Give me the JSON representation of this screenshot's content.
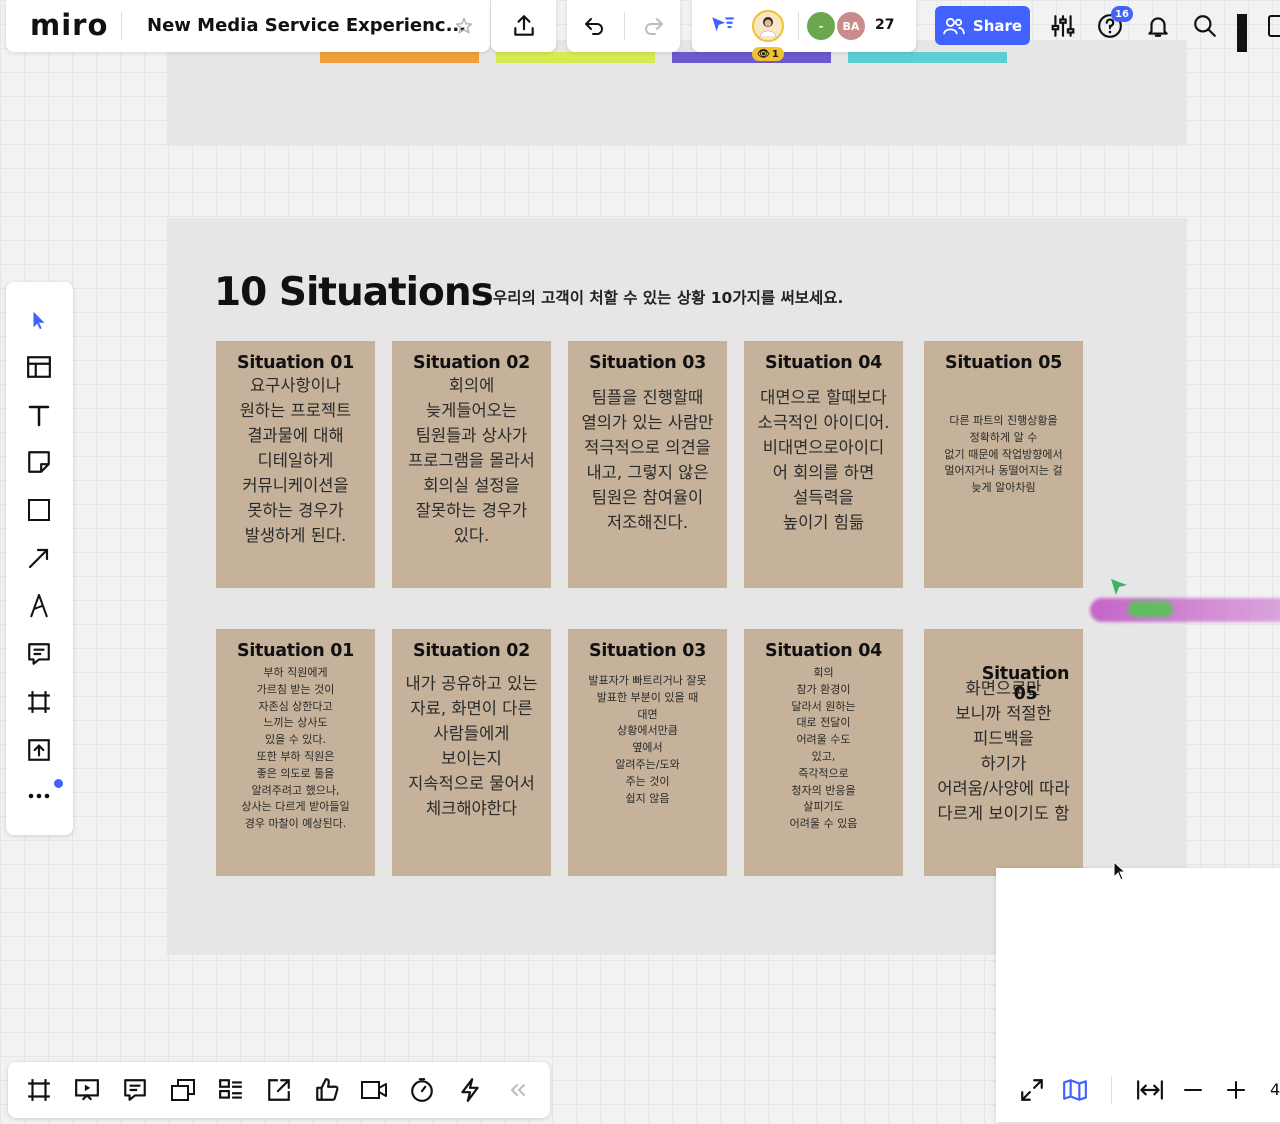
{
  "app": {
    "logo": "miro",
    "board_name": "New Media Service Experienc...",
    "share_label": "Share",
    "collaborator_count": "27",
    "viewer_count": "1",
    "help_badge": "16",
    "zoom_level": "4",
    "avatar_initials_ba": "BA",
    "avatar_initials_green": "-"
  },
  "board": {
    "title": "10 Situations",
    "subtitle": "우리의 고객이 처할 수 있는 상황 10가지를 써보세요.",
    "row1": [
      {
        "title": "Situation 01",
        "text": "요구사항이나\n원하는 프로젝트\n결과물에 대해\n디테일하게\n커뮤니케이션을\n못하는 경우가\n발생하게 된다."
      },
      {
        "title": "Situation 02",
        "text": "회의에\n늦게들어오는\n팀원들과 상사가\n프로그램을 몰라서\n회의실 설정을\n잘못하는 경우가\n있다."
      },
      {
        "title": "Situation 03",
        "text": "팀플을 진행할때\n열의가 있는 사람만\n적극적으로 의견을\n내고, 그렇지 않은\n팀원은 참여율이\n저조해진다."
      },
      {
        "title": "Situation 04",
        "text": "대면으로 할때보다\n소극적인 아이디어.\n비대면으로아이디\n어 회의를 하면\n설득력을\n높이기 힘듦"
      },
      {
        "title": "Situation 05",
        "text": "다른 파트의 진행상황을\n정확하게 알 수\n없기 때문에 작업방향에서\n멀어지거나 동떨어지는 걸\n늦게 알아차림"
      }
    ],
    "row2": [
      {
        "title": "Situation 01",
        "text": "부하 직원에게\n가르침 받는 것이\n자존심 상한다고\n느끼는 상사도\n있을 수 있다.\n또한 부하 직원은\n좋은 의도로 툴을\n알려주려고 했으나,\n상사는 다르게 받아들일\n경우 마찰이 예상된다."
      },
      {
        "title": "Situation 02",
        "text": "내가 공유하고 있는\n자료, 화면이 다른\n사람들에게\n보이는지\n지속적으로 물어서\n체크해야한다"
      },
      {
        "title": "Situation 03",
        "text": "발표자가 빠트리거나 잘못\n발표한 부분이 있을 때\n대면\n상황에서만큼\n옆에서\n알려주는/도와\n주는 것이\n쉽지 않음"
      },
      {
        "title": "Situation 04",
        "text": "회의\n참가 환경이\n달라서 원하는\n대로 전달이\n어려울 수도\n있고,\n즉각적으로\n청자의 반응을\n살피기도\n어려울 수 있음"
      },
      {
        "title": "Situation 05",
        "text": "화면으로만\n보니까 적절한\n피드백을\n하기가\n어려움/사양에 따라\n다르게 보이기도 함"
      }
    ]
  },
  "colors": {
    "accent": "#4262ff",
    "card": "#c6b29a",
    "frame": "#e6e6e6",
    "tab_orange": "#f0a13c",
    "tab_lime": "#d7ea4f",
    "tab_purple": "#6a5acd",
    "tab_teal": "#5ccfd4"
  },
  "icons": {
    "left_toolbar": [
      "select-cursor-icon",
      "table-icon",
      "text-icon",
      "sticky-note-icon",
      "shape-icon",
      "arrow-line-icon",
      "pen-icon",
      "comment-icon",
      "frame-icon",
      "upload-icon",
      "more-icon"
    ],
    "bottom_toolbar": [
      "frames-icon",
      "presentation-icon",
      "comments-list-icon",
      "cards-icon",
      "kanban-icon",
      "share-screen-icon",
      "like-icon",
      "video-call-icon",
      "timer-icon",
      "lightning-icon",
      "collapse-icon"
    ]
  }
}
